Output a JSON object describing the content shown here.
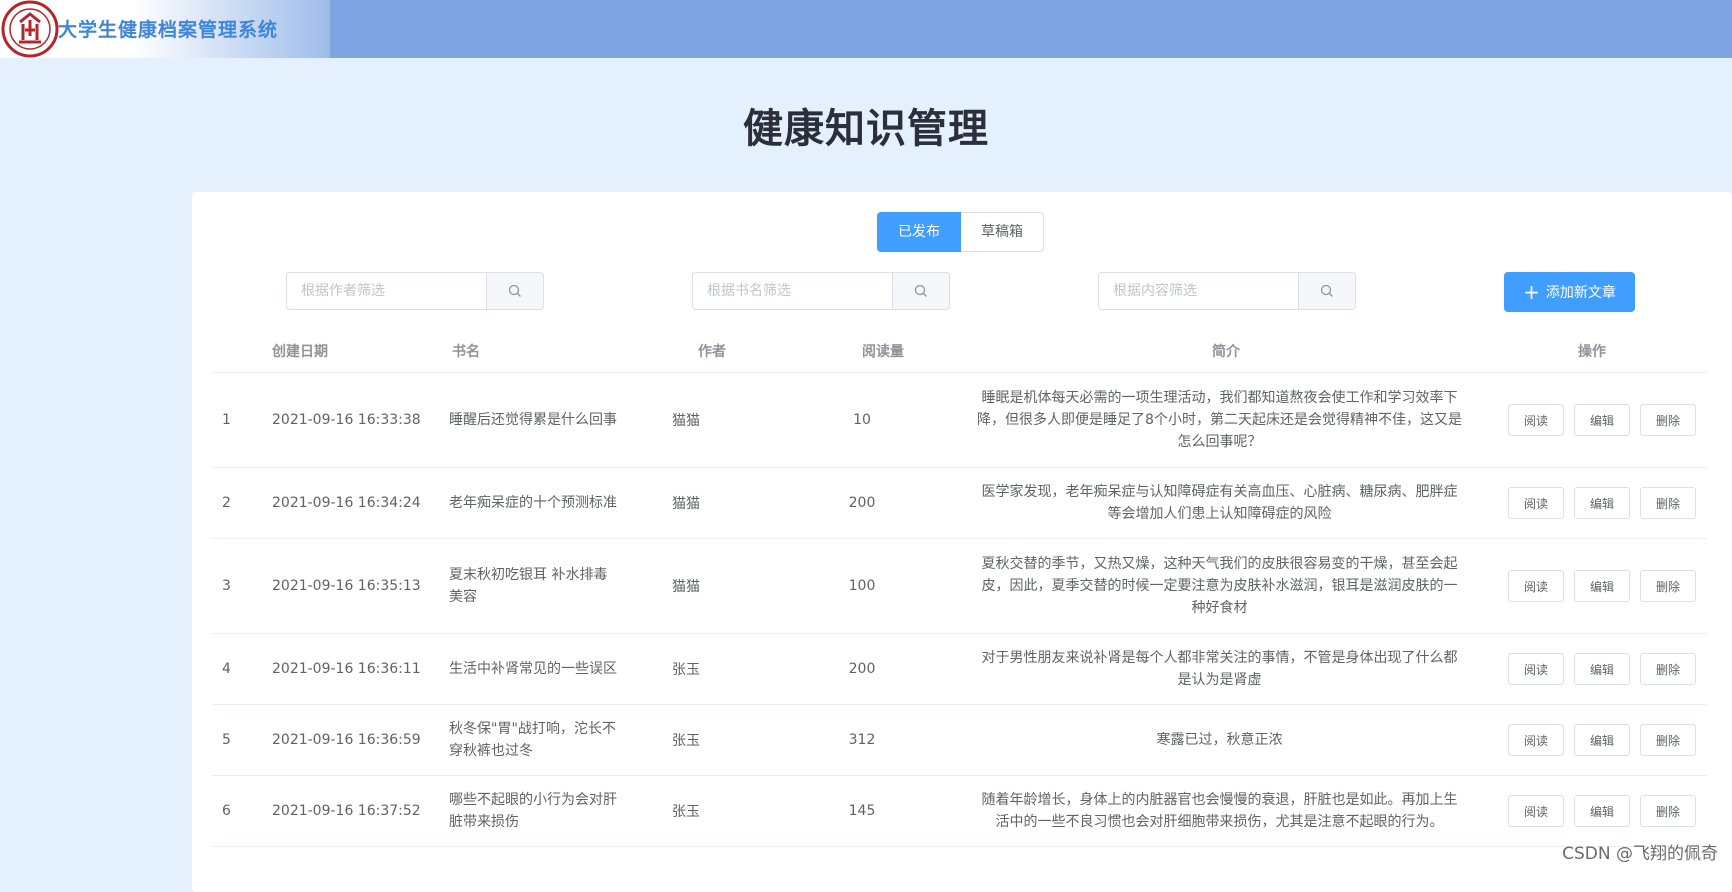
{
  "header": {
    "app_title": "大学生健康档案管理系统",
    "logo_icon": "university-seal-logo",
    "colors": {
      "bar": "#7ea5e2",
      "title": "#3f86d8"
    }
  },
  "page": {
    "title": "健康知识管理"
  },
  "tabs": [
    {
      "label": "已发布",
      "active": true
    },
    {
      "label": "草稿箱",
      "active": false
    }
  ],
  "filters": {
    "author_placeholder": "根据作者筛选",
    "book_placeholder": "根据书名筛选",
    "content_placeholder": "根据内容筛选",
    "search_icon": "search-icon"
  },
  "actions": {
    "add_label": "添加新文章",
    "accent": "#409eff"
  },
  "table": {
    "headers": {
      "date": "创建日期",
      "book": "书名",
      "author": "作者",
      "reads": "阅读量",
      "intro": "简介",
      "ops": "操作"
    },
    "op_labels": {
      "read": "阅读",
      "edit": "编辑",
      "delete": "删除"
    },
    "rows": [
      {
        "idx": "1",
        "date": "2021-09-16 16:33:38",
        "book": "睡醒后还觉得累是什么回事",
        "author": "猫猫",
        "reads": "10",
        "intro": "睡眠是机体每天必需的一项生理活动，我们都知道熬夜会使工作和学习效率下降，但很多人即便是睡足了8个小时，第二天起床还是会觉得精神不佳，这又是怎么回事呢？"
      },
      {
        "idx": "2",
        "date": "2021-09-16 16:34:24",
        "book": "老年痴呆症的十个预测标准",
        "author": "猫猫",
        "reads": "200",
        "intro": "医学家发现，老年痴呆症与认知障碍症有关高血压、心脏病、糖尿病、肥胖症等会增加人们患上认知障碍症的风险"
      },
      {
        "idx": "3",
        "date": "2021-09-16 16:35:13",
        "book": "夏末秋初吃银耳 补水排毒美容",
        "author": "猫猫",
        "reads": "100",
        "intro": "夏秋交替的季节，又热又燥，这种天气我们的皮肤很容易变的干燥，甚至会起皮，因此，夏季交替的时候一定要注意为皮肤补水滋润，银耳是滋润皮肤的一种好食材"
      },
      {
        "idx": "4",
        "date": "2021-09-16 16:36:11",
        "book": "生活中补肾常见的一些误区",
        "author": "张玉",
        "reads": "200",
        "intro": "对于男性朋友来说补肾是每个人都非常关注的事情，不管是身体出现了什么都是认为是肾虚"
      },
      {
        "idx": "5",
        "date": "2021-09-16 16:36:59",
        "book": "秋冬保\"胃\"战打响，沱长不穿秋裤也过冬",
        "author": "张玉",
        "reads": "312",
        "intro": "寒露已过，秋意正浓"
      },
      {
        "idx": "6",
        "date": "2021-09-16 16:37:52",
        "book": "哪些不起眼的小行为会对肝脏带来损伤",
        "author": "张玉",
        "reads": "145",
        "intro": "随着年龄增长，身体上的内脏器官也会慢慢的衰退，肝脏也是如此。再加上生活中的一些不良习惯也会对肝细胞带来损伤，尤其是注意不起眼的行为。"
      }
    ]
  },
  "watermark": "CSDN @飞翔的佩奇"
}
